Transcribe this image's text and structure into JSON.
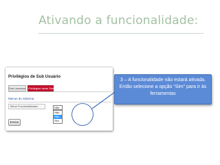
{
  "slide": {
    "title": "Ativando a funcionalidade:",
    "callout_text": "3 – A funcionalidade não estará ativada. Então selecione a opção “Sim” para ir às ferramentas"
  },
  "screenshot": {
    "heading": "Privilégios de Sub Usuário",
    "tabs": [
      "Sub Usuários",
      "Privilégios deste Sub Usuário"
    ],
    "section_title": "Menus do Sistema",
    "feature_label": "Meus Funcionalidades",
    "select": {
      "value": "Não",
      "options": [
        "Não",
        "Não",
        "Sim"
      ],
      "highlighted_index": 1
    },
    "submit_label": "Enviar"
  },
  "colors": {
    "title": "#a3c0a3",
    "callout_bg": "#5b8ad6",
    "active_tab": "#c8102e",
    "annotation": "#3f6db3"
  }
}
